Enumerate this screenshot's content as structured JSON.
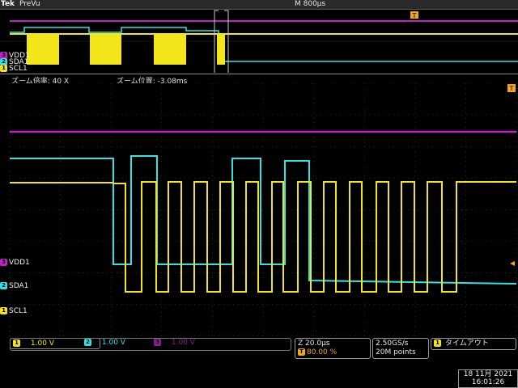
{
  "header": {
    "brand": "Tek",
    "mode": "PreVu",
    "timebase": "M 800µs"
  },
  "zoom": {
    "factor_label": "ズーム倍率: 40 X",
    "position_label": "ズーム位置: -3.08ms"
  },
  "labels": {
    "vdd": "VDD1",
    "sda": "SDA1",
    "scl": "SCL1",
    "ch1": "1",
    "ch2": "2",
    "ch3": "3",
    "trig": "T"
  },
  "channels": [
    {
      "num": "1",
      "scale": "1.00 V",
      "color": "#f2e61a"
    },
    {
      "num": "2",
      "scale": "1.00 V",
      "color": "#2ee3e6"
    },
    {
      "num": "3",
      "scale": "1.00 V",
      "color": "#c022c8"
    }
  ],
  "horizontal": {
    "zoom_time": "Z 20.0µs",
    "trigger_pos": "80.00 %"
  },
  "acquisition": {
    "rate": "2.50GS/s",
    "points": "20M points"
  },
  "trigger": {
    "ch": "1",
    "status": "タイムアウト"
  },
  "datetime": {
    "date": "18 11月 2021",
    "time": "16:01:26"
  }
}
